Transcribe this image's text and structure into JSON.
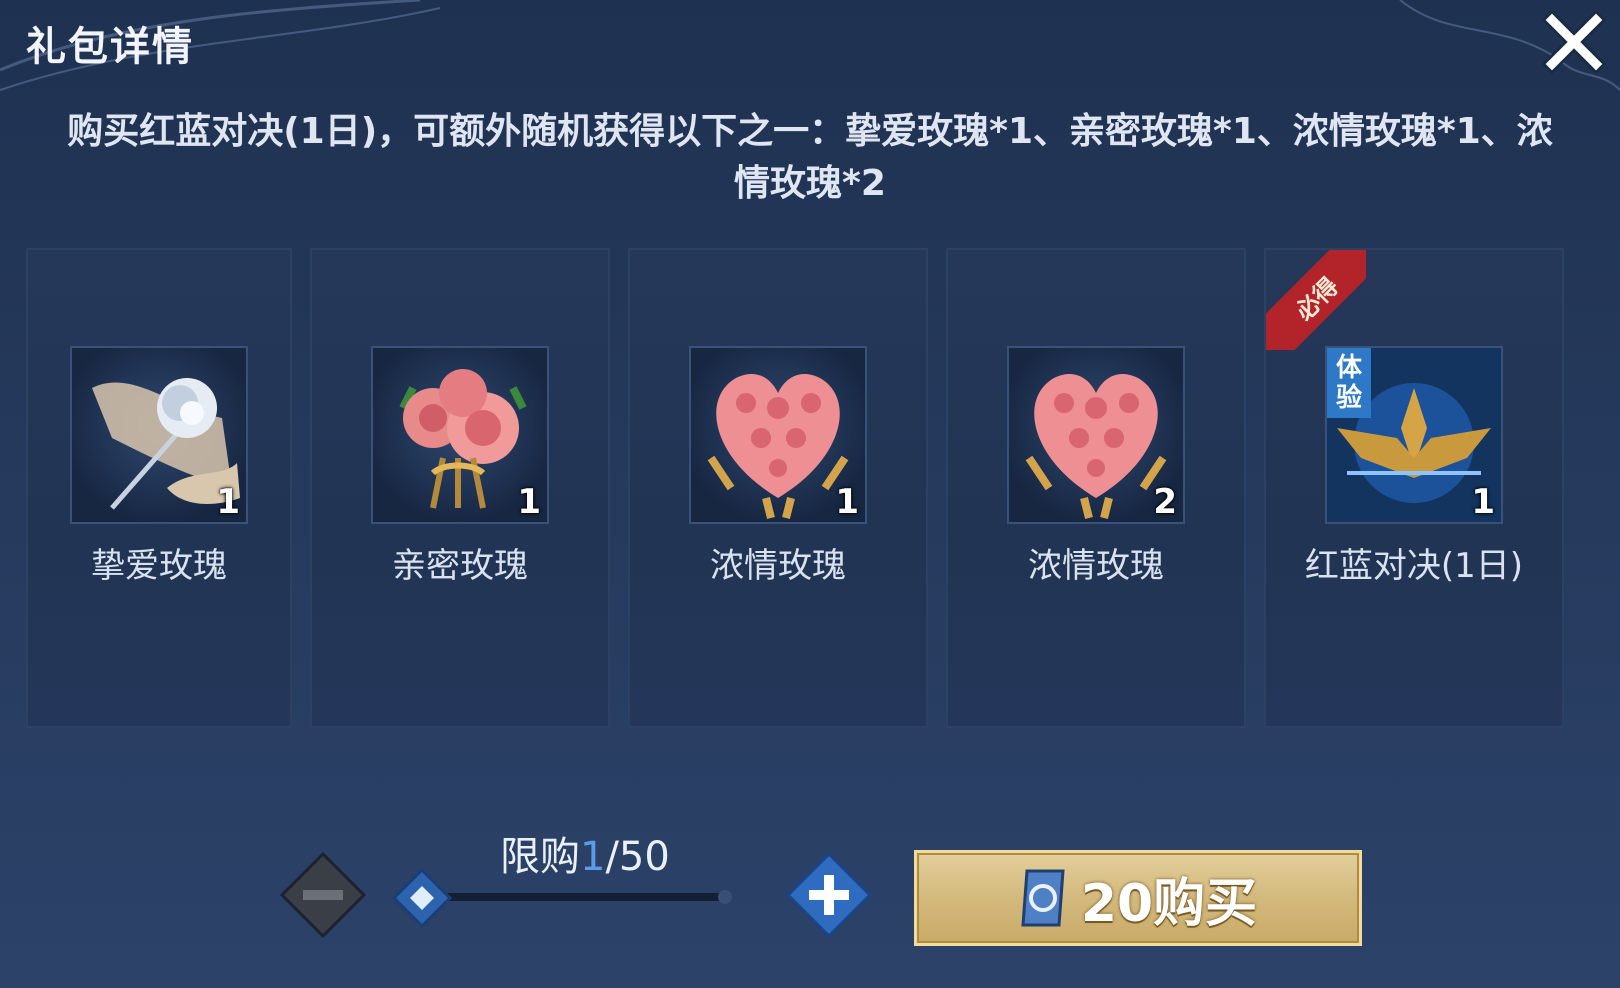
{
  "header": {
    "title": "礼包详情"
  },
  "description": "购买红蓝对决(1日)，可额外随机获得以下之一：挚爱玫瑰*1、亲密玫瑰*1、浓情玫瑰*1、浓情玫瑰*2",
  "items": [
    {
      "name": "挚爱玫瑰",
      "qty": "1",
      "icon": "white-rose-icon"
    },
    {
      "name": "亲密玫瑰",
      "qty": "1",
      "icon": "rose-bouquet-icon"
    },
    {
      "name": "浓情玫瑰",
      "qty": "1",
      "icon": "heart-rose-bouquet-icon"
    },
    {
      "name": "浓情玫瑰",
      "qty": "2",
      "icon": "heart-rose-bouquet-icon"
    },
    {
      "name": "红蓝对决(1日)",
      "qty": "1",
      "icon": "red-blue-duel-icon",
      "badge": "必得",
      "tag": [
        "体",
        "验"
      ]
    }
  ],
  "purchase": {
    "limit_prefix": "限购",
    "limit_current": "1",
    "limit_suffix": "/50",
    "buy_label": "20购买",
    "quantity_fraction": 0.02
  },
  "colors": {
    "background": "#25395c",
    "accent_blue": "#5a9bea",
    "buy_gold": "#d3b97c",
    "badge_red": "#b3232a"
  }
}
